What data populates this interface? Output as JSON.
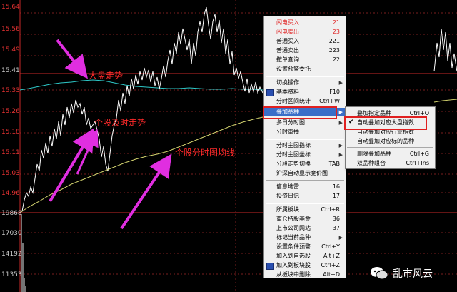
{
  "y_axis_labels": [
    "15.64",
    "15.56",
    "15.49",
    "15.41",
    "15.33",
    "15.26",
    "15.18",
    "15.11",
    "15.03",
    "14.96",
    "19868",
    "17030",
    "14192",
    "11353"
  ],
  "annotations": {
    "market_trend": "大盘走势",
    "stock_realtime": "个股及时走势",
    "avg_line": "个股分时图均线"
  },
  "context_menu": {
    "items": [
      {
        "label": "闪电买入",
        "shortcut": "21",
        "style": "red"
      },
      {
        "label": "闪电卖出",
        "shortcut": "23",
        "style": "red"
      },
      {
        "label": "普通买入",
        "shortcut": "221"
      },
      {
        "label": "普通卖出",
        "shortcut": "223"
      },
      {
        "label": "撤单查询",
        "shortcut": "22"
      },
      {
        "label": "设置预警委托",
        "shortcut": ""
      },
      {
        "label": "切换操作",
        "shortcut": "",
        "submenu": true
      },
      {
        "label": "基本资料",
        "shortcut": "F10",
        "icon": true
      },
      {
        "label": "分时区间统计",
        "shortcut": "Ctrl+W"
      },
      {
        "label": "叠加品种",
        "shortcut": "",
        "submenu": true,
        "highlighted": true
      },
      {
        "label": "多日分时图",
        "shortcut": "",
        "submenu": true
      },
      {
        "label": "分时重播",
        "shortcut": ""
      },
      {
        "label": "分时主图指标",
        "shortcut": "",
        "submenu": true
      },
      {
        "label": "分时主图坐标",
        "shortcut": "",
        "submenu": true
      },
      {
        "label": "分段走势切换",
        "shortcut": "TAB"
      },
      {
        "label": "沪深自动显示竞价图",
        "shortcut": ""
      },
      {
        "label": "信息地雷",
        "shortcut": "16"
      },
      {
        "label": "投资日记",
        "shortcut": "17"
      },
      {
        "label": "所属板块",
        "shortcut": "Ctrl+R"
      },
      {
        "label": "重仓持股基金",
        "shortcut": "36"
      },
      {
        "label": "上市公司网站",
        "shortcut": "37"
      },
      {
        "label": "标记当前品种",
        "shortcut": "",
        "submenu": true
      },
      {
        "label": "设置条件预警",
        "shortcut": "Ctrl+Y"
      },
      {
        "label": "加入到自选股",
        "shortcut": "Alt+Z"
      },
      {
        "label": "加入到板块股",
        "shortcut": "Ctrl+Z",
        "icon": true
      },
      {
        "label": "从板块中删除",
        "shortcut": "Alt+D"
      }
    ]
  },
  "submenu": {
    "items": [
      {
        "label": "叠加指定品种",
        "shortcut": "Ctrl+O"
      },
      {
        "label": "自动叠加对应大盘指数",
        "shortcut": "",
        "checked": true
      },
      {
        "label": "自动叠加对应行业指数",
        "shortcut": ""
      },
      {
        "label": "自动叠加对应标的品种",
        "shortcut": ""
      },
      {
        "label": "删除叠加品种",
        "shortcut": "Ctrl+G"
      },
      {
        "label": "双品种组合",
        "shortcut": "Ctrl+Ins"
      }
    ]
  },
  "watermark": "乱市风云",
  "colors": {
    "price_line": "#ffffff",
    "avg_line": "#d2d26e",
    "market_line": "#2ec8c8",
    "grid_red": "#c82828",
    "arrow": "#e02ee0"
  }
}
